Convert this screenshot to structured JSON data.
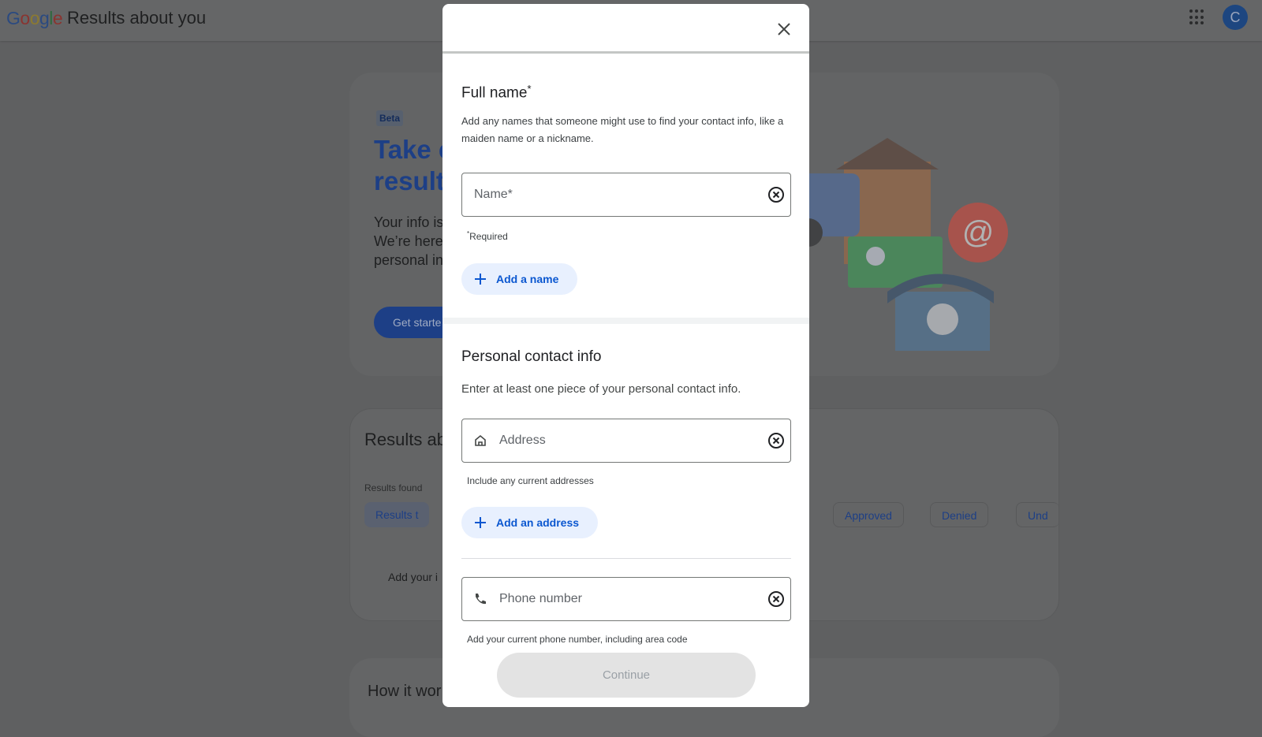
{
  "header": {
    "logo": "Google",
    "title": "Results about you",
    "avatar_initial": "C",
    "icons": [
      "apps-grid-icon",
      "avatar"
    ]
  },
  "background": {
    "beta": "Beta",
    "hero_title_partial": "Take c\nresult",
    "hero_text_partial": "Your info is\nWe’re here\npersonal in",
    "get_started_partial": "Get starte",
    "results_title_partial": "Results abo",
    "results_found": "Results found",
    "chips": [
      "Results t",
      "Approved",
      "Denied",
      "Und"
    ],
    "add_info_partial": "Add your i",
    "how_title_partial": "How it wor"
  },
  "modal": {
    "full_name": {
      "title": "Full name",
      "required_mark": "*",
      "description": "Add any names that someone might use to find your contact info, like a maiden name or a nickname.",
      "name_placeholder": "Name*",
      "name_value": "",
      "required_hint": "Required",
      "add_label": "Add a name"
    },
    "contact": {
      "title": "Personal contact info",
      "description": "Enter at least one piece of your personal contact info.",
      "address_placeholder": "Address",
      "address_value": "",
      "address_hint": "Include any current addresses",
      "add_address_label": "Add an address",
      "phone_placeholder": "Phone number",
      "phone_value": "",
      "phone_hint": "Add your current phone number, including area code"
    },
    "continue_label": "Continue"
  },
  "colors": {
    "accent": "#0b57d0",
    "chip_bg": "#e8f0fe",
    "disabled_bg": "#e3e3e3"
  }
}
